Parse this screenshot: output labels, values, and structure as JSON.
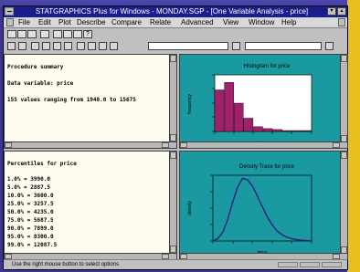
{
  "window": {
    "title": "STATGRAPHICS Plus for Windows - MONDAY.SGP - [One Variable Analysis - price]"
  },
  "menu": [
    "File",
    "Edit",
    "Plot",
    "Describe",
    "Compare",
    "Relate",
    "Advanced",
    "View",
    "Window",
    "Help"
  ],
  "summary_pane": {
    "heading": "Procedure summary",
    "variable_line": "Data variable: price",
    "values_line": "155 values ranging from 1940.0 to 15675"
  },
  "percentile_pane": {
    "heading": "Percentiles for price",
    "rows": [
      "1.0% = 3990.0",
      "5.0% = 2887.5",
      "10.0% = 3600.0",
      "25.0% = 3257.5",
      "50.0% = 4235.0",
      "75.0% = 5687.5",
      "90.0% = 7899.0",
      "95.0% = 8300.0",
      "99.0% = 12087.5"
    ]
  },
  "histogram": {
    "title": "Histogram for price",
    "xlabel": "price",
    "ylabel": "frequency",
    "bar_color": "#a0206a",
    "panel_color": "#1a9aa0",
    "plot_bg": "#ffffff"
  },
  "density": {
    "title": "Density Trace for price",
    "xlabel": "price",
    "ylabel": "density",
    "line_color": "#202080"
  },
  "status": {
    "text": "Use the right mouse button to select options"
  },
  "chart_data": [
    {
      "type": "bar",
      "title": "Histogram for price",
      "xlabel": "price",
      "ylabel": "frequency",
      "values": [
        44,
        52,
        30,
        14,
        5,
        3,
        2,
        1,
        1,
        1
      ]
    },
    {
      "type": "line",
      "title": "Density Trace for price",
      "xlabel": "price",
      "ylabel": "density",
      "x": [
        0,
        1,
        2,
        3,
        4,
        5,
        6,
        7,
        8,
        9,
        10,
        11,
        12,
        13,
        14,
        15,
        16,
        17,
        18,
        19,
        20
      ],
      "y": [
        0.0,
        0.04,
        0.14,
        0.34,
        0.62,
        0.86,
        1.0,
        0.98,
        0.88,
        0.72,
        0.55,
        0.39,
        0.26,
        0.16,
        0.1,
        0.06,
        0.035,
        0.02,
        0.012,
        0.006,
        0.003
      ]
    }
  ]
}
